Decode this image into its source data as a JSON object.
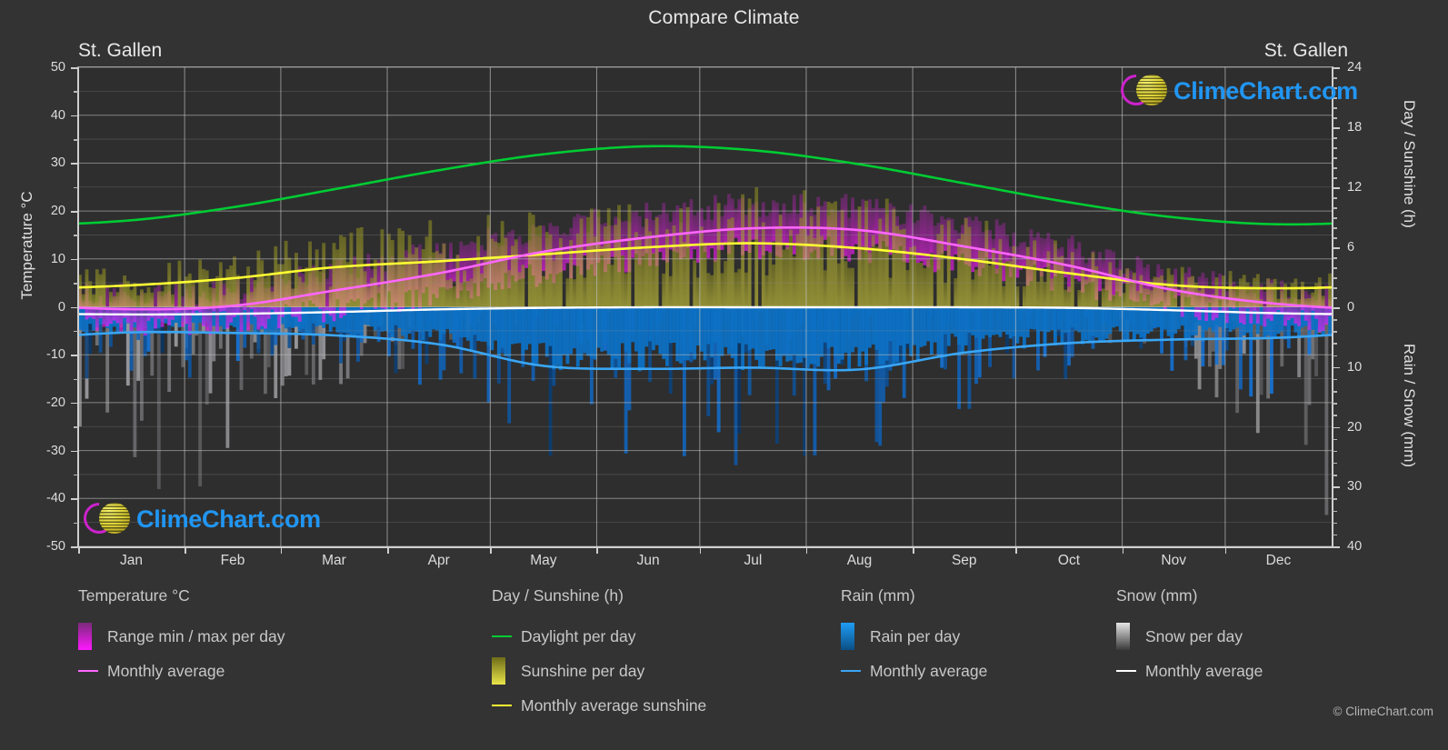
{
  "header": {
    "title": "Compare Climate",
    "location_left": "St. Gallen",
    "location_right": "St. Gallen"
  },
  "watermark": {
    "text": "ClimeChart.com",
    "logo_ring_color": "#cc22cc",
    "logo_globe_color": "#ddd238",
    "text_color": "#2196f3"
  },
  "copyright": "© ClimeChart.com",
  "axes": {
    "left": {
      "label": "Temperature °C",
      "ticks": [
        "50",
        "40",
        "30",
        "20",
        "10",
        "0",
        "-10",
        "-20",
        "-30",
        "-40",
        "-50"
      ],
      "values": [
        50,
        40,
        30,
        20,
        10,
        0,
        -10,
        -20,
        -30,
        -40,
        -50
      ],
      "min": -50,
      "max": 50
    },
    "right_top": {
      "label": "Day / Sunshine (h)",
      "ticks": [
        "24",
        "18",
        "12",
        "6",
        "0"
      ],
      "values": [
        24,
        18,
        12,
        6,
        0
      ],
      "min": 0,
      "max": 24
    },
    "right_bottom": {
      "label": "Rain / Snow (mm)",
      "ticks": [
        "0",
        "10",
        "20",
        "30",
        "40"
      ],
      "values": [
        0,
        10,
        20,
        30,
        40
      ],
      "min": 0,
      "max": 40
    },
    "bottom": {
      "ticks": [
        "Jan",
        "Feb",
        "Mar",
        "Apr",
        "May",
        "Jun",
        "Jul",
        "Aug",
        "Sep",
        "Oct",
        "Nov",
        "Dec"
      ]
    }
  },
  "legend": {
    "groups": [
      {
        "heading": "Temperature °C",
        "items": [
          {
            "label": "Range min / max per day",
            "marker": "gradient-box",
            "color": "#ff00ff"
          },
          {
            "label": "Monthly average",
            "marker": "line",
            "color": "#ff66ff"
          }
        ]
      },
      {
        "heading": "Day / Sunshine (h)",
        "items": [
          {
            "label": "Daylight per day",
            "marker": "line",
            "color": "#00cc33"
          },
          {
            "label": "Sunshine per day",
            "marker": "gradient-box",
            "color": "#e8e432"
          },
          {
            "label": "Monthly average sunshine",
            "marker": "line",
            "color": "#ffff33"
          }
        ]
      },
      {
        "heading": "Rain (mm)",
        "items": [
          {
            "label": "Rain per day",
            "marker": "gradient-box",
            "color": "#0b8bf0"
          },
          {
            "label": "Monthly average",
            "marker": "line",
            "color": "#3aa6f5"
          }
        ]
      },
      {
        "heading": "Snow (mm)",
        "items": [
          {
            "label": "Snow per day",
            "marker": "gradient-box",
            "color": "#e8e8e8"
          },
          {
            "label": "Monthly average",
            "marker": "line",
            "color": "#ffffff"
          }
        ]
      }
    ]
  },
  "chart_data": {
    "type": "line",
    "title": "Compare Climate",
    "subtitle": "St. Gallen",
    "xlabel": "",
    "ylabel": "Temperature °C",
    "ylim": [
      -50,
      50
    ],
    "grid": true,
    "legend_position": "below",
    "categories": [
      "Jan",
      "Feb",
      "Mar",
      "Apr",
      "May",
      "Jun",
      "Jul",
      "Aug",
      "Sep",
      "Oct",
      "Nov",
      "Dec"
    ],
    "series": [
      {
        "name": "Daylight per day",
        "unit": "h",
        "axis": "right_top",
        "color": "#00cc33",
        "values": [
          8.7,
          10.0,
          11.8,
          13.7,
          15.3,
          16.1,
          15.7,
          14.3,
          12.4,
          10.5,
          9.0,
          8.3
        ]
      },
      {
        "name": "Monthly average sunshine",
        "unit": "h",
        "axis": "right_top",
        "color": "#ffff33",
        "values": [
          2.2,
          2.9,
          4.0,
          4.6,
          5.3,
          6.0,
          6.4,
          5.9,
          4.8,
          3.4,
          2.2,
          1.9
        ]
      },
      {
        "name": "Monthly average temperature",
        "unit": "°C",
        "axis": "left",
        "color": "#ff66ff",
        "values": [
          -0.5,
          0.2,
          3.4,
          7.0,
          11.5,
          14.5,
          16.4,
          16.0,
          12.6,
          8.6,
          3.5,
          0.6
        ]
      },
      {
        "name": "Rain monthly average",
        "unit": "mm",
        "axis": "right_bottom",
        "color": "#3aa6f5",
        "values": [
          4.2,
          4.3,
          4.7,
          6.2,
          9.8,
          10.3,
          10.1,
          10.4,
          7.6,
          6.0,
          5.4,
          5.1
        ]
      },
      {
        "name": "Snow monthly average",
        "unit": "mm",
        "axis": "right_bottom",
        "color": "#ffffff",
        "values": [
          1.2,
          1.1,
          0.8,
          0.35,
          0.1,
          0.0,
          0.0,
          0.0,
          0.0,
          0.1,
          0.5,
          1.0
        ]
      }
    ],
    "bands": [
      {
        "name": "Range min / max per day",
        "unit": "°C",
        "axis": "left",
        "color": "#ff00ff",
        "min_values": [
          -3.4,
          -3.0,
          -0.4,
          2.6,
          6.9,
          10.0,
          12.0,
          11.8,
          8.6,
          5.0,
          0.6,
          -2.2
        ],
        "max_values": [
          2.4,
          3.6,
          7.6,
          11.7,
          16.3,
          19.3,
          21.3,
          20.7,
          16.9,
          12.4,
          6.5,
          3.2
        ]
      },
      {
        "name": "Sunshine per day",
        "unit": "h",
        "axis": "right_top",
        "color": "#e8e432",
        "values": [
          2.2,
          2.9,
          4.0,
          4.6,
          5.3,
          6.0,
          6.4,
          5.9,
          4.8,
          3.4,
          2.2,
          1.9
        ]
      },
      {
        "name": "Rain per day",
        "unit": "mm",
        "axis": "right_bottom",
        "color": "#0b8bf0",
        "values": [
          4.2,
          4.3,
          4.7,
          6.2,
          9.8,
          10.3,
          10.1,
          10.4,
          7.6,
          6.0,
          5.4,
          5.1
        ]
      },
      {
        "name": "Snow per day",
        "unit": "mm",
        "axis": "right_bottom",
        "color": "#e8e8e8",
        "values": [
          12.0,
          10.0,
          7.0,
          4.0,
          1.0,
          0.0,
          0.0,
          0.0,
          0.0,
          1.0,
          5.0,
          10.0
        ]
      }
    ]
  }
}
